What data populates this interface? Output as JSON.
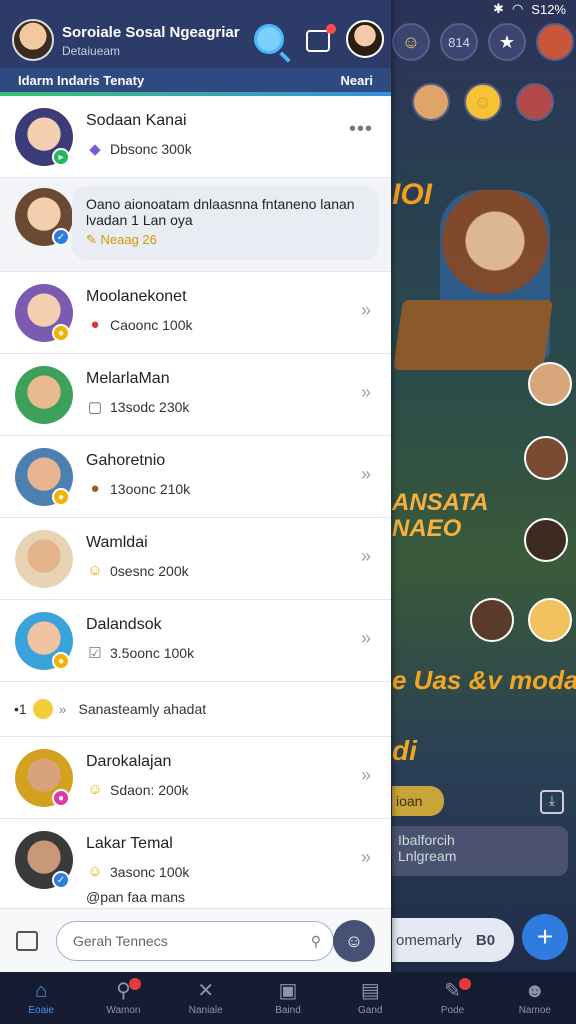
{
  "status_bar": {
    "battery": "S12%"
  },
  "header": {
    "title": "Soroiale Sosal Ngeagriar",
    "subtitle": "Detaiueam",
    "subbar_left": "Idarm Indaris Tenaty",
    "subbar_right": "Neari"
  },
  "chats": [
    {
      "name": "Sodaan Kanai",
      "sub": "Dbsonc 300k",
      "icon": "gem-icon",
      "glyph": "◆",
      "glyph_color": "#7c5ad9",
      "badge_color": "#23b85a",
      "avatar_bg": "#3c3c78",
      "more": "•••"
    },
    {
      "bubble_line1": "Oano aionoatam dnlaasnna fntaneno lanan",
      "bubble_line2": "lvadan 1 Lan oya",
      "meta": "Neaag 26",
      "avatar_bg": "#6b4a33",
      "badge_color": "#2e7ce0"
    },
    {
      "name": "Moolanekonet",
      "sub": "Caoonc 100k",
      "icon": "heart-icon",
      "glyph": "●",
      "glyph_color": "#e0303a",
      "badge_color": "#f1b400",
      "avatar_bg": "#7a5bb0"
    },
    {
      "name": "MelarlaMan",
      "sub": "13sodc 230k",
      "icon": "box-icon",
      "glyph": "▢",
      "glyph_color": "#666",
      "badge_color": "#2e7ce0",
      "avatar_bg": "#3da15c"
    },
    {
      "name": "Gahoretnio",
      "sub": "13oonc 210k",
      "icon": "coin-icon",
      "glyph": "●",
      "glyph_color": "#9b5a20",
      "badge_color": "#f1b400",
      "avatar_bg": "#4d7fb0"
    },
    {
      "name": "Wamldai",
      "sub": "0sesnc 200k",
      "icon": "smile-icon",
      "glyph": "☺",
      "glyph_color": "#e0a800",
      "badge_color": "#e0e0e0",
      "avatar_bg": "#e8d3b5"
    },
    {
      "name": "Dalandsok",
      "sub": "3.5oonc 100k",
      "icon": "check-box-icon",
      "glyph": "☑",
      "glyph_color": "#777",
      "badge_color": "#f1b400",
      "avatar_bg": "#3aa3d9"
    },
    {
      "system": "Sanasteamly ahadat",
      "prefix": "•1",
      "suffix": "»"
    },
    {
      "name": "Darokalajan",
      "sub": "Sdaon: 200k",
      "icon": "smile-icon",
      "glyph": "☺",
      "glyph_color": "#e0a800",
      "badge_color": "#d83aa8",
      "avatar_bg": "#d4a020"
    },
    {
      "name": "Lakar Temal",
      "sub": "3asonc 100k",
      "icon": "smile-icon",
      "glyph": "☺",
      "glyph_color": "#e0a800",
      "badge_color": "#2e7ce0",
      "avatar_bg": "#3a3a3a",
      "extra": "@pan faa mans"
    }
  ],
  "composer": {
    "placeholder": "Gerah Tennecs"
  },
  "background": {
    "top_label": "814",
    "title_banner": "IOI",
    "banner2_line1": "ANSATA",
    "banner2_line2": "NAEO",
    "banner3": "e Uas &v modan",
    "banner4": "di",
    "pill": "ioan",
    "box_line1": "Ibalforcih",
    "box_line2": "Lnlgream",
    "input": "omemarly",
    "input_badge": "B0"
  },
  "nav": [
    {
      "label": "Eoaie",
      "icon": "home-icon",
      "glyph": "⌂",
      "active": true
    },
    {
      "label": "Wamon",
      "icon": "search-icon",
      "glyph": "⚲",
      "badge": true
    },
    {
      "label": "Naniale",
      "icon": "tools-icon",
      "glyph": "✕"
    },
    {
      "label": "Baind",
      "icon": "bag-icon",
      "glyph": "▣"
    },
    {
      "label": "Gand",
      "icon": "card-icon",
      "glyph": "▤"
    },
    {
      "label": "Pode",
      "icon": "wrench-icon",
      "glyph": "✎",
      "badge": true
    },
    {
      "label": "Namoe",
      "icon": "profile-icon",
      "glyph": "☻"
    }
  ]
}
